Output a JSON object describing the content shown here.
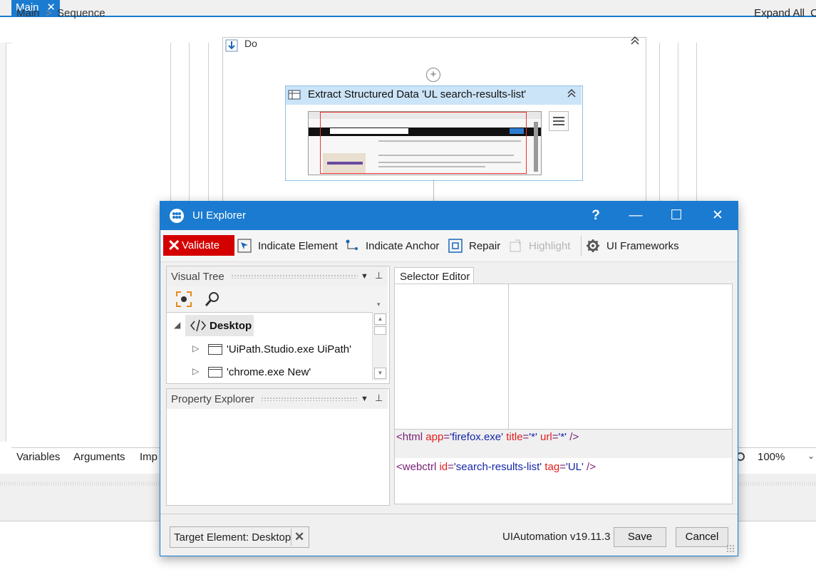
{
  "tabs": {
    "main_label": "Main",
    "close_glyph": "✕"
  },
  "breadcrumb": {
    "items": [
      "Main",
      "Sequence"
    ],
    "separator": ">"
  },
  "header_actions": {
    "expand_all": "Expand All",
    "collapse_cut": "C"
  },
  "designer": {
    "do_title": "Do",
    "activity_title": "Extract Structured Data 'UL  search-results-list'"
  },
  "bottom_tabs": [
    "Variables",
    "Arguments",
    "Imp"
  ],
  "zoom": {
    "value": "100%"
  },
  "ui_explorer": {
    "title": "UI Explorer",
    "window_buttons": {
      "help": "?",
      "minimize": "—",
      "maximize": "☐",
      "close": "✕"
    },
    "toolbar": {
      "validate": "Validate",
      "indicate_element": "Indicate Element",
      "indicate_anchor": "Indicate Anchor",
      "repair": "Repair",
      "highlight": "Highlight",
      "ui_frameworks": "UI Frameworks"
    },
    "visual_tree": {
      "label": "Visual Tree",
      "items": [
        {
          "label": "Desktop",
          "expanded": true,
          "selected": true
        },
        {
          "label": "'UiPath.Studio.exe UiPath'",
          "expanded": false
        },
        {
          "label": "'chrome.exe New'",
          "expanded": false
        }
      ]
    },
    "property_explorer": {
      "label": "Property Explorer"
    },
    "selector_editor": {
      "tab_label": "Selector Editor",
      "lines": [
        {
          "tag": "html",
          "attrs": [
            {
              "name": "app",
              "value": "'firefox.exe'"
            },
            {
              "name": "title",
              "value": "'*'"
            },
            {
              "name": "url",
              "value": "'*'"
            }
          ]
        },
        {
          "tag": "webctrl",
          "attrs": [
            {
              "name": "id",
              "value": "'search-results-list'"
            },
            {
              "name": "tag",
              "value": "'UL'"
            }
          ]
        }
      ]
    },
    "footer": {
      "target_element": "Target Element: Desktop",
      "version": "UIAutomation v19.11.3",
      "save": "Save",
      "cancel": "Cancel"
    }
  },
  "colors": {
    "accent": "#1a7bd0",
    "validate_bg": "#d40000",
    "activity_header": "#cce4f7"
  }
}
